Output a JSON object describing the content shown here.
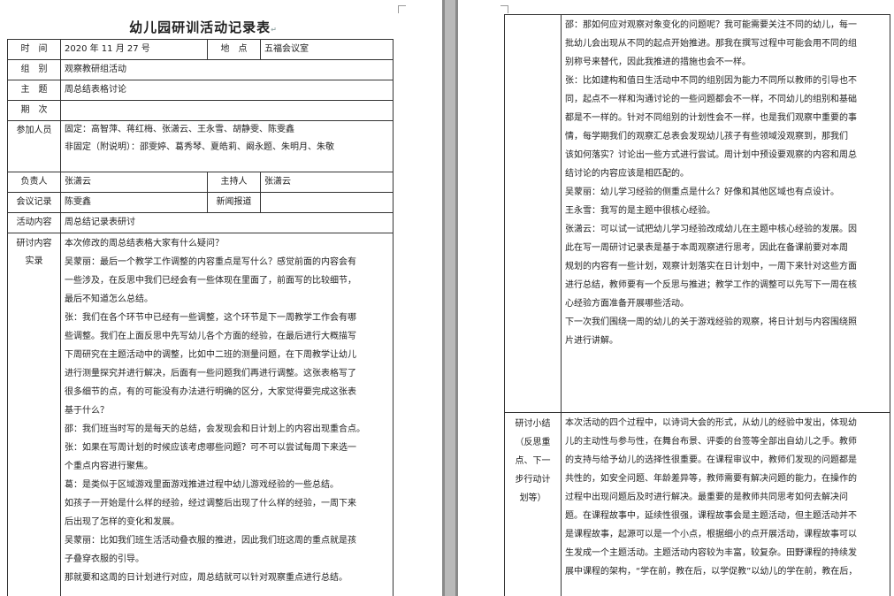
{
  "title": "幼儿园研训活动记录表",
  "rows": {
    "time_label": "时　间",
    "time_value": "2020 年 11 月 27 号",
    "place_label": "地　点",
    "place_value": "五福会议室",
    "group_label": "组　别",
    "group_value": "观察教研组活动",
    "topic_label": "主　题",
    "topic_value": "周总结表格讨论",
    "period_label": "期　次",
    "period_value": "",
    "participants_label": "参加人员",
    "participants_fixed": "固定：高智萍、蒋红梅、张潇云、王永雪、胡静雯、陈雯鑫",
    "participants_other": "非固定（附说明）：邵雯婷、葛秀琴、夏皓莉、阚永题、朱明月、朱敬",
    "leader_label": "负责人",
    "leader_value": "张潇云",
    "host_label": "主持人",
    "host_value": "张潇云",
    "recorder_label": "会议记录",
    "recorder_value": "陈雯鑫",
    "news_label": "新闻报道",
    "news_value": "",
    "content_label": "活动内容",
    "content_value": "周总结记录表研讨"
  },
  "record_label": [
    "研讨内容",
    "实录"
  ],
  "record_left": [
    "本次修改的周总结表格大家有什么疑问？",
    "吴蒙丽：最后一个教学工作调整的内容重点是写什么？感觉前面的内容会有",
    "一些涉及，在反思中我们已经会有一些体现在里面了，前面写的比较细节，",
    "最后不知道怎么总结。",
    "张：我们在各个环节中已经有一些调整，这个环节是下一周教学工作会有哪",
    "些调整。我们在上面反思中先写幼儿各个方面的经验，在最后进行大概描写",
    "下周研究在主题活动中的调整，比如中二班的测量问题，在下周教学让幼儿",
    "进行测量探究并进行解决，后面有一些问题我们再进行调整。这张表格写了",
    "很多细节的点，有的可能没有办法进行明确的区分，大家觉得要完成这张表",
    "基于什么？",
    "邵：我们班当时写的是每天的总结，会发现会和日计划上的内容出现重合点。",
    "张：如果在写周计划的时候应该考虑哪些问题？可不可以尝试每周下来选一",
    "个重点内容进行聚焦。",
    "葛：是类似于区域游戏里面游戏推进过程中幼儿游戏经验的一些总结。",
    "如孩子一开始是什么样的经验，经过调整后出现了什么样的经验，一周下来",
    "后出现了怎样的变化和发展。",
    "吴蒙丽：比如我们班生活活动叠衣服的推进，因此我们班这周的重点就是孩",
    "子叠穿衣服的引导。",
    "那就要和这周的日计划进行对应，周总结就可以针对观察重点进行总结。"
  ],
  "record_right": [
    "邵：那如何应对观察对象变化的问题呢？我可能需要关注不同的幼儿，每一",
    "批幼儿会出现从不同的起点开始推进。那我在撰写过程中可能会用不同的组",
    "别称号来替代，因此我推进的措施也会不一样。",
    "张：比如建构和值日生活动中不同的组别因为能力不同所以教师的引导也不",
    "同，起点不一样和沟通讨论的一些问题都会不一样，不同幼儿的组别和基础",
    "都是不一样的。针对不同组别的计划性会不一样，也是我们观察中重要的事",
    "情，每学期我们的观察汇总表会发现幼儿孩子有些领域没观察到，那我们",
    "该如何落实？讨论出一些方式进行尝试。周计划中预设要观察的内容和周总",
    "结讨论的内容应该是相匹配的。",
    "吴蒙丽：幼儿学习经验的侧重点是什么？好像和其他区域也有点设计。",
    "王永雪：我写的是主题中很核心经验。",
    "张潇云：可以试一试把幼儿学习经验改成幼儿在主题中核心经验的发展。因",
    "此在写一周研讨记录表是基于本周观察进行思考，因此在备课前要对本周",
    "规划的内容有一些计划，观察计划落实在日计划中，一周下来针对这些方面",
    "进行总结，教师要有一个反思与推进；教学工作的调整可以先写下一周在核",
    "心经验方面准备开展哪些活动。",
    "下一次我们围绕一周的幼儿的关于游戏经验的观察，将日计划与内容围绕照",
    "片进行讲解。",
    "",
    ""
  ],
  "summary_label": [
    "研讨小结",
    "（反思重",
    "点、下一",
    "步行动计",
    "划等）"
  ],
  "summary": [
    "本次活动的四个过程中，以诗词大会的形式，从幼儿的经验中发出，体现幼",
    "儿的主动性与参与性，在舞台布景、评委的台签等全部出自幼儿之手。教师",
    "的支持与给予幼儿的选择性很重要。在课程审议中，教师们发现的问题都是",
    "共性的，如安全问题、年龄差异等，教师需要有解决问题的能力，在操作的",
    "过程中出现问题后及时进行解决。最重要的是教师共同思考如何去解决问",
    "题。在课程故事中，延续性很强，课程故事会是主题活动，但主题活动并不",
    "是课程故事，起源可以是一个小点，根据细小的点开展活动，课程故事可以",
    "生发成一个主题活动。主题活动内容较为丰富，较复杂。田野课程的持续发",
    "展中课程的架构，“学在前，教在后，以学促教”以幼儿的学在前，教在后，"
  ]
}
